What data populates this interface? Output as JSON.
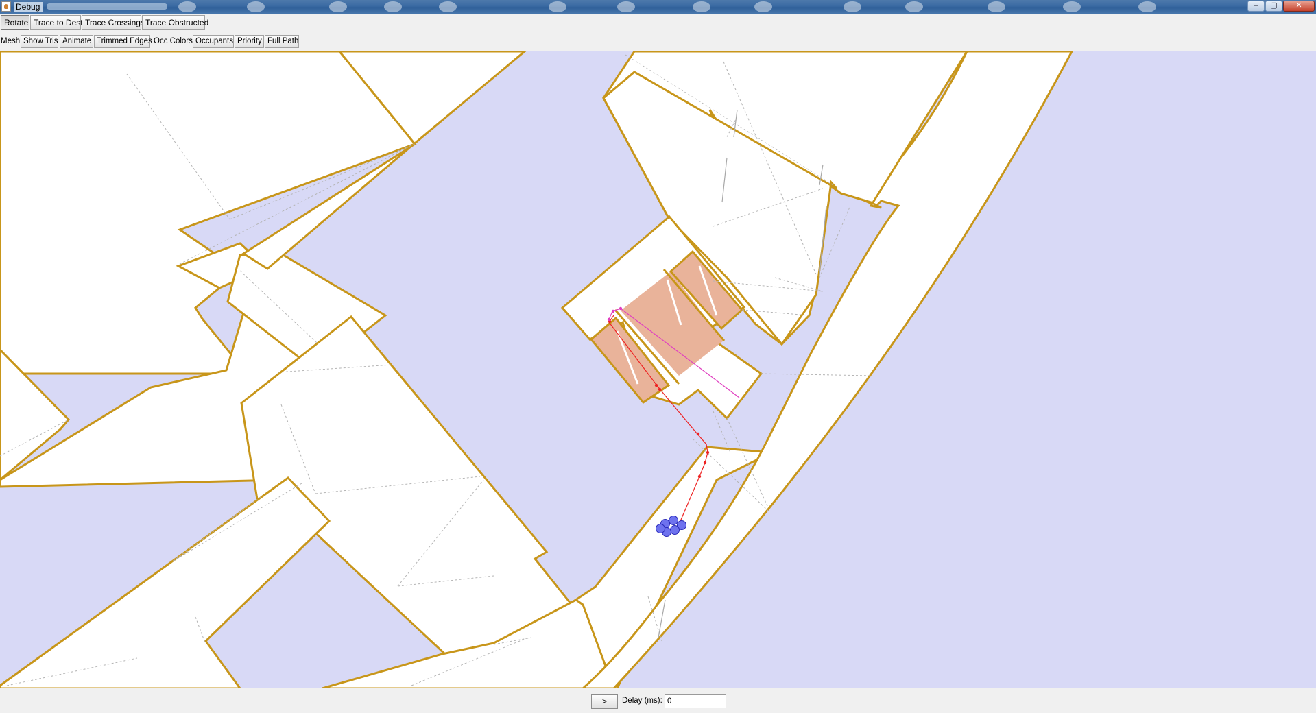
{
  "window": {
    "title": "Debug",
    "controls": {
      "minimize": "–",
      "maximize": "▢",
      "close": "✕"
    }
  },
  "toolbar": {
    "buttons": [
      "Rotate",
      "Trace to Dest",
      "Trace Crossings",
      "Trace Obstructed"
    ],
    "active": "Rotate"
  },
  "options": {
    "mesh_label": "Mesh:",
    "mesh_buttons": [
      "Show Tris",
      "Animate",
      "Trimmed Edges"
    ],
    "occ_label": "Occ Colors:",
    "occ_buttons": [
      "Occupants",
      "Priority",
      "Full Path"
    ]
  },
  "bottom": {
    "step_label": ">",
    "delay_label": "Delay (ms):",
    "delay_value": "0"
  },
  "colors": {
    "background": "#d8d9f6",
    "walkable": "#ffffff",
    "wall": "#c8961a",
    "occupied_zone": "#e9b39a",
    "path": "#ee2222",
    "path_alt": "#e040c0",
    "agents": "#6e72ee",
    "mesh_edges": "#b4b4b4"
  },
  "icons": [
    "app-icon",
    "minimize-icon",
    "maximize-icon",
    "close-icon"
  ]
}
